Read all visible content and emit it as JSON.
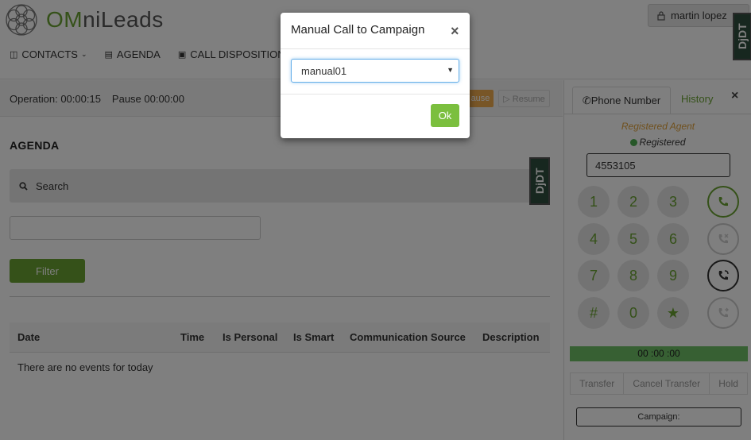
{
  "app": {
    "logo_prefix": "OM",
    "logo_suffix": "niLeads"
  },
  "user": {
    "name": "martin lopez",
    "icon": "lock-icon"
  },
  "nav": [
    {
      "label": "CONTACTS",
      "icon": "book-icon"
    },
    {
      "label": "AGENDA",
      "icon": "calendar-icon"
    },
    {
      "label": "CALL DISPOSITIONS",
      "icon": "disk-icon"
    }
  ],
  "debug_toolbar": {
    "label": "DjDT"
  },
  "status_bar": {
    "operation": "Operation: 00:00:15",
    "pause_time": "Pause 00:00:00",
    "pause_label": "ause",
    "resume_label": "▷ Resume"
  },
  "agenda": {
    "title": "AGENDA",
    "search_label": "Search",
    "filter_label": "Filter",
    "columns": [
      "Date",
      "Time",
      "Is Personal",
      "Is Smart",
      "Communication Source",
      "Description"
    ],
    "empty_message": "There are no events for today"
  },
  "phone": {
    "tab_phone": "Phone Number",
    "tab_history": "History",
    "close": "×",
    "registered_agent": "Registered Agent",
    "registered_status": "Registered",
    "number": "4553105",
    "keys": [
      "1",
      "2",
      "3",
      "4",
      "5",
      "6",
      "7",
      "8",
      "9",
      "#",
      "0",
      "★"
    ],
    "timer": "00 :00 :00",
    "actions": [
      "Transfer",
      "Cancel Transfer",
      "Hold"
    ],
    "campaign_label": "Campaign:"
  },
  "modal": {
    "title": "Manual Call to Campaign",
    "close": "×",
    "selected_campaign": "manual01",
    "ok_label": "Ok"
  },
  "colors": {
    "brand_green": "#6aa332",
    "pause_orange": "#f0ad4e",
    "timer_green": "#6ec066"
  }
}
